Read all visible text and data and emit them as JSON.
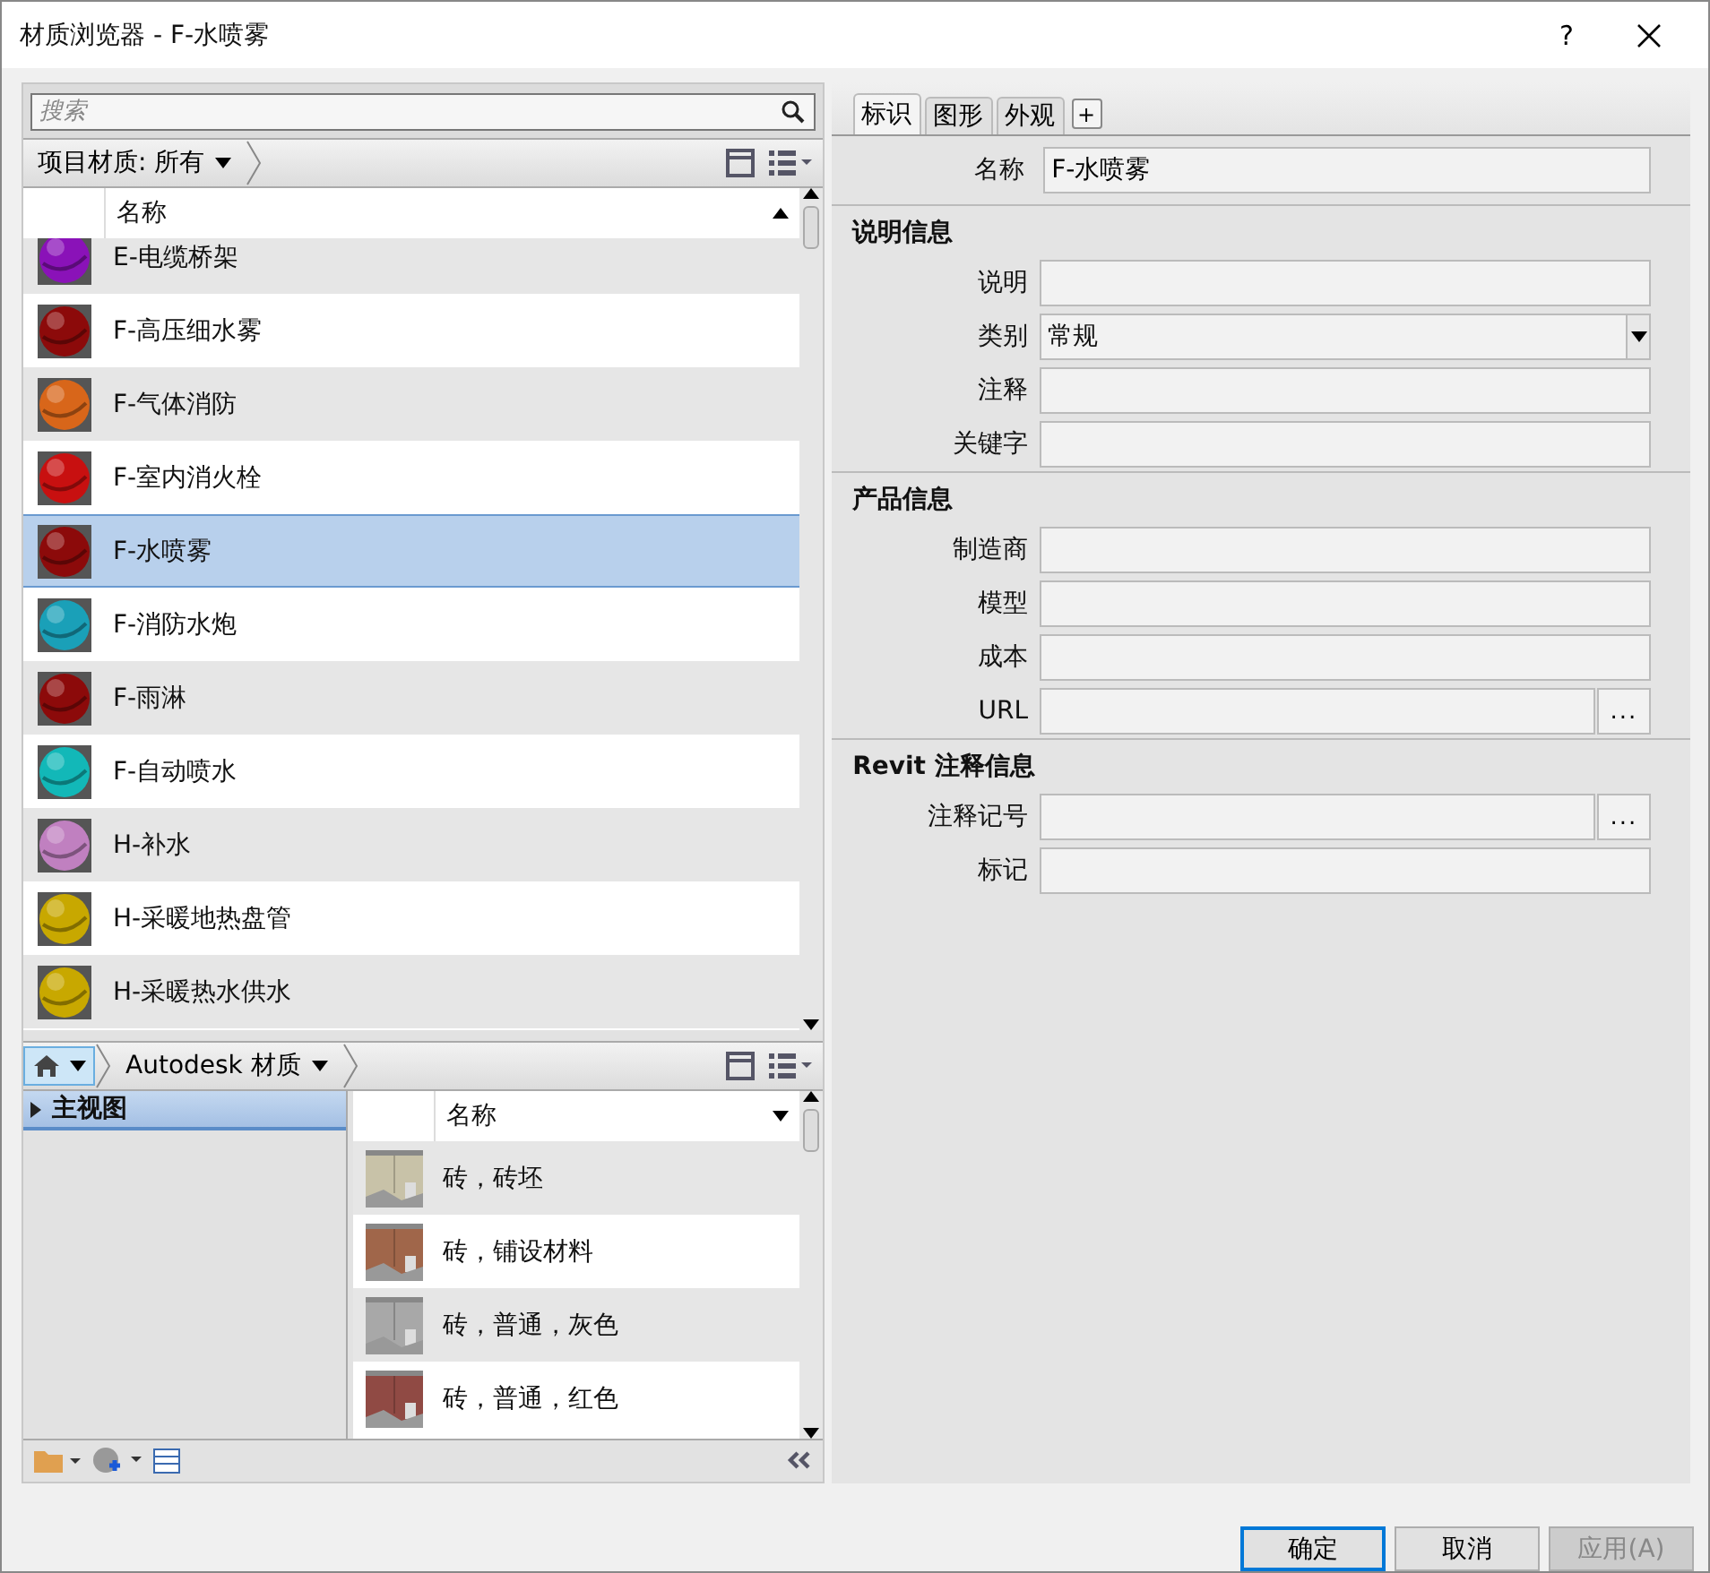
{
  "window": {
    "title": "材质浏览器 - F-水喷雾",
    "help": "?"
  },
  "search": {
    "placeholder": "搜索"
  },
  "project_bar": {
    "label": "项目材质: 所有"
  },
  "project_list": {
    "column": "名称",
    "ascending": true,
    "rows": [
      {
        "name": "E-电缆桥架",
        "color": "#8a12b8",
        "selected": false
      },
      {
        "name": "F-高压细水雾",
        "color": "#8c0a0a",
        "selected": false
      },
      {
        "name": "F-气体消防",
        "color": "#d8661a",
        "selected": false
      },
      {
        "name": "F-室内消火栓",
        "color": "#c81010",
        "selected": false
      },
      {
        "name": "F-水喷雾",
        "color": "#8c0a0a",
        "selected": true
      },
      {
        "name": "F-消防水炮",
        "color": "#1aa0b8",
        "selected": false
      },
      {
        "name": "F-雨淋",
        "color": "#8c0a0a",
        "selected": false
      },
      {
        "name": "F-自动喷水",
        "color": "#12b8b8",
        "selected": false
      },
      {
        "name": "H-补水",
        "color": "#c080c0",
        "selected": false
      },
      {
        "name": "H-采暖地热盘管",
        "color": "#c8a800",
        "selected": false
      },
      {
        "name": "H-采暖热水供水",
        "color": "#c8a800",
        "selected": false
      }
    ]
  },
  "library_bar": {
    "label": "Autodesk 材质"
  },
  "library_tree": [
    {
      "label": "主视图",
      "selected": true,
      "expanded": false
    }
  ],
  "library_list": {
    "column": "名称",
    "ascending": false,
    "rows": [
      {
        "name": "砖，砖坯",
        "color": "#c8c2a8"
      },
      {
        "name": "砖，铺设材料",
        "color": "#a0664a"
      },
      {
        "name": "砖，普通，灰色",
        "color": "#a8a8a8"
      },
      {
        "name": "砖，普通，红色",
        "color": "#904a44"
      }
    ]
  },
  "tabs": [
    {
      "label": "标识",
      "selected": true
    },
    {
      "label": "图形",
      "selected": false
    },
    {
      "label": "外观",
      "selected": false
    }
  ],
  "add_tab_button": "+",
  "name_field": {
    "label": "名称",
    "value": "F-水喷雾"
  },
  "sections": [
    {
      "title": "说明信息",
      "fields": [
        {
          "label": "说明",
          "kind": "text"
        },
        {
          "label": "类别",
          "value": "常规",
          "kind": "dropdown"
        },
        {
          "label": "注释",
          "kind": "text"
        },
        {
          "label": "关键字",
          "kind": "text"
        }
      ]
    },
    {
      "title": "产品信息",
      "fields": [
        {
          "label": "制造商",
          "kind": "text"
        },
        {
          "label": "模型",
          "kind": "text"
        },
        {
          "label": "成本",
          "kind": "text"
        },
        {
          "label": "URL",
          "kind": "browse",
          "button": "..."
        }
      ]
    },
    {
      "title": "Revit 注释信息",
      "fields": [
        {
          "label": "注释记号",
          "kind": "browse",
          "button": "..."
        },
        {
          "label": "标记",
          "kind": "text"
        }
      ]
    }
  ],
  "buttons": [
    {
      "label": "确定",
      "default": true,
      "disabled": false
    },
    {
      "label": "取消",
      "default": false,
      "disabled": false
    },
    {
      "label": "应用(A)",
      "default": false,
      "disabled": true
    }
  ]
}
